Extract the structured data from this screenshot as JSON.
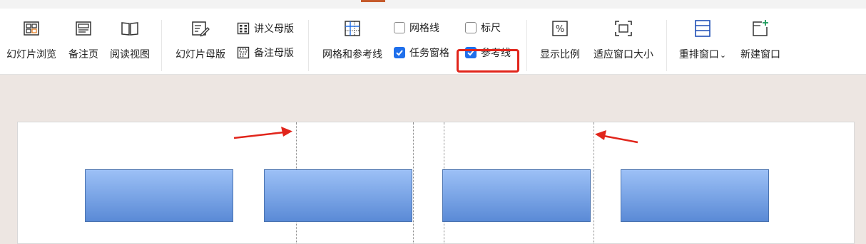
{
  "ribbon": {
    "slide_browse": "幻灯片浏览",
    "notes_page": "备注页",
    "reading_view": "阅读视图",
    "slide_master": "幻灯片母版",
    "handout_master": "讲义母版",
    "notes_master": "备注母版",
    "grid_guides": "网格和参考线",
    "gridlines": "网格线",
    "ruler": "标尺",
    "task_pane": "任务窗格",
    "guides": "参考线",
    "zoom": "显示比例",
    "fit_window": "适应窗口大小",
    "arrange": "重排窗口",
    "arrange_chevron": "⌄",
    "new_window": "新建窗口"
  },
  "checkboxes": {
    "gridlines": false,
    "ruler": false,
    "task_pane": true,
    "guides": true
  },
  "colors": {
    "accent_check": "#1f6feb",
    "highlight_box": "#e1251b",
    "annotation_arrow": "#e1251b",
    "shape_fill_top": "#9cc0f6",
    "shape_fill_bottom": "#5a8ad6"
  },
  "icons": {
    "slide_browse": "slide-grid-icon",
    "notes_page": "notes-page-icon",
    "reading_view": "open-book-icon",
    "slide_master": "master-edit-icon",
    "handout_master": "handout-grid-icon",
    "notes_master": "notes-master-icon",
    "grid_guides": "grid-guides-icon",
    "zoom": "percent-icon",
    "fit_window": "fit-frame-icon",
    "arrange": "stack-windows-icon",
    "new_window": "new-window-icon"
  }
}
